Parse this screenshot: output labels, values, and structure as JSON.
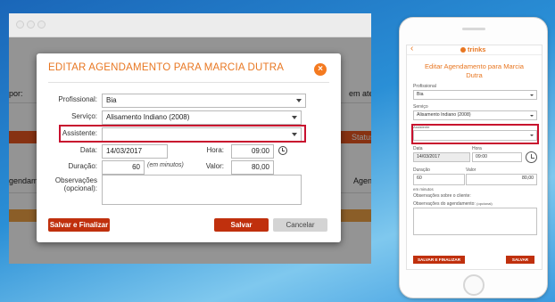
{
  "desktop": {
    "background": {
      "left_label": "por:",
      "right_label": "em atendim",
      "status_label": "Status",
      "left_row_label": "gendamento",
      "right_row_label": "Agendime"
    },
    "modal": {
      "title": "EDITAR AGENDAMENTO PARA MARCIA DUTRA",
      "close_glyph": "×",
      "fields": {
        "profissional": {
          "label": "Profissional:",
          "value": "Bia"
        },
        "servico": {
          "label": "Serviço:",
          "value": "Alisamento Indiano (2008)"
        },
        "assistente": {
          "label": "Assistente:",
          "value": ""
        },
        "data": {
          "label": "Data:",
          "value": "14/03/2017"
        },
        "hora": {
          "label": "Hora:",
          "value": "09:00"
        },
        "duracao": {
          "label": "Duração:",
          "value": "60",
          "hint": "(em minutos)"
        },
        "valor": {
          "label": "Valor:",
          "value": "80,00"
        },
        "observacoes": {
          "label_line1": "Observações",
          "label_line2": "(opcional):",
          "value": ""
        }
      },
      "buttons": {
        "save_finalize": "Salvar e Finalizar",
        "save": "Salvar",
        "cancel": "Cancelar"
      }
    }
  },
  "mobile": {
    "back_glyph": "‹",
    "logo_text": "trinks",
    "title_line1": "Editar Agendamento para Marcia",
    "title_line2": "Dutra",
    "fields": {
      "profissional": {
        "label": "Profissional",
        "value": "Bia"
      },
      "servico": {
        "label": "Serviço",
        "value": "Alisamento Indiano (2008)"
      },
      "assistente": {
        "label": "Assistente",
        "value": ""
      },
      "data": {
        "label": "Data",
        "value": "14/03/2017"
      },
      "hora": {
        "label": "Hora",
        "value": "09:00"
      },
      "duracao": {
        "label": "Duração",
        "value": "60",
        "hint": "em minutos"
      },
      "valor": {
        "label": "Valor",
        "value": "80,00"
      },
      "obs_cliente": {
        "label": "Observações sobre o cliente:"
      },
      "obs_agendamento": {
        "label": "Observações do agendamento:",
        "hint": "(opcional)"
      }
    },
    "buttons": {
      "save_finalize": "SALVAR E FINALIZAR",
      "save": "SALVAR"
    }
  },
  "colors": {
    "accent": "#e87722",
    "button_red": "#c0300d",
    "highlight_red": "#c8102e"
  }
}
